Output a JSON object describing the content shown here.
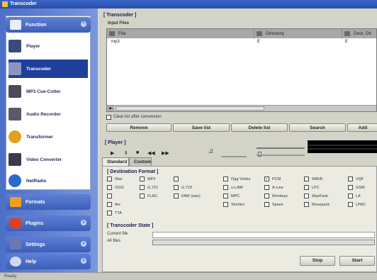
{
  "window": {
    "title": "Transcoder"
  },
  "sidebar": {
    "function_header": "Function",
    "items": [
      {
        "label": "Player",
        "icon": "player-icon"
      },
      {
        "label": "Transcoder",
        "icon": "transcoder-icon"
      },
      {
        "label": "MP3 Cue-Cutter",
        "icon": "scissors-icon"
      },
      {
        "label": "Audio Recorder",
        "icon": "microphone-icon"
      },
      {
        "label": "Transformer",
        "icon": "transformer-icon"
      },
      {
        "label": "Video Converter",
        "icon": "video-icon"
      },
      {
        "label": "NetRadio",
        "icon": "radio-icon"
      }
    ],
    "formats_header": "Formats",
    "plugins_header": "Plugins",
    "settings_header": "Settings",
    "help_header": "Help"
  },
  "main": {
    "title": "[ Transcoder ]",
    "input_files_label": "Input Files",
    "columns": [
      "File",
      "Directory",
      "Dest. Dir"
    ],
    "rows": [
      {
        "file": "mp3",
        "directory": "E",
        "dest": "E"
      }
    ],
    "autoclear_label": "Clear list after conversion",
    "buttons": {
      "remove": "Remove",
      "save_list": "Save list",
      "delete_list": "Delete list",
      "search": "Search",
      "add": "Add"
    },
    "player_title": "[ Player ]",
    "tabs": [
      "Standard",
      "Custom"
    ],
    "destination_title": "[ Destination Format ]",
    "formats": [
      [
        "Wav",
        "MP3",
        "",
        "Ogg Vorbis",
        "PCM",
        "WAVE",
        "VQF"
      ],
      [
        "OGG",
        "G.721",
        "G.723",
        "u-LAW",
        "A-Law",
        "LPC",
        "GSM"
      ],
      [
        "",
        "FLAC",
        "FAW (wav)",
        "MPC",
        "Monkeys",
        "WavPack",
        "LA"
      ],
      [
        "Avi",
        "",
        "",
        "Shorten",
        "Speex",
        "Musepack",
        "LPAC"
      ],
      [
        "TTA",
        "",
        "",
        "",
        "",
        "",
        ""
      ]
    ],
    "state_title": "[ Transcoder State ]",
    "current_file_label": "Current file",
    "all_files_label": "All files",
    "bottom_buttons": [
      "Stop",
      "Start"
    ],
    "pcm_checked": true
  },
  "statusbar": {
    "text": "Ready"
  }
}
